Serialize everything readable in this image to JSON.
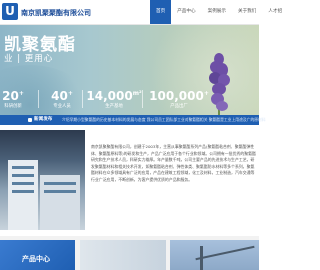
{
  "header": {
    "logo_letter": "U",
    "company_name": "南京凯聚聚酯有限公司",
    "nav": [
      "首页",
      "产品中心",
      "案例展示",
      "关于我们",
      "人才招"
    ]
  },
  "banner": {
    "slogan_main": "凯聚氨酯",
    "slogan_sub": "业 | 更用心",
    "stats": [
      {
        "value": "20",
        "sup": "+",
        "label": "科研创新"
      },
      {
        "value": "40",
        "sup": "+",
        "label": "专业人员"
      },
      {
        "value": "14,000",
        "sup": "m²",
        "label": "生产基地"
      },
      {
        "value": "100,000",
        "sup": "+",
        "label": "产品出厂"
      }
    ]
  },
  "news": {
    "label": "新闻发布",
    "ticker": "介绍早期小型聚氨酯的历史基本材料的发展与态度    我公司员工团队部工业对聚氨酯相关  聚氨酯是工业上用途及广的原材料"
  },
  "about": {
    "text": "南京凯聚聚酯有限公司，创建于2003年，主营从事聚氨酯系列产品(聚氨酯粘合剂、聚氨酯弹性体、聚氨酯原料等)的研发和生产，产品广泛应用于各个行业和领域。公司拥有一批优秀的聚氨酯研究和生产技术人员，科研实力雄厚。年产量数千吨，公司主要产品的先进技术与生产工艺，研发聚氨酯材料和相关技术开发，如聚氨酯粘合剂、弹性体类、聚氨酯防水材料等多个系列，聚氨酯材料在众多领域具有广泛的应用，产品在建筑工程领域，化工及材料，工业制造，汽车交通等行业广泛应用，不断创新，为客户提供优质的产品和服务。"
  },
  "products": {
    "title": "产品中心"
  },
  "colors": {
    "brand_blue": "#1f5fb2",
    "banner_teal": "#a7c8cf"
  }
}
